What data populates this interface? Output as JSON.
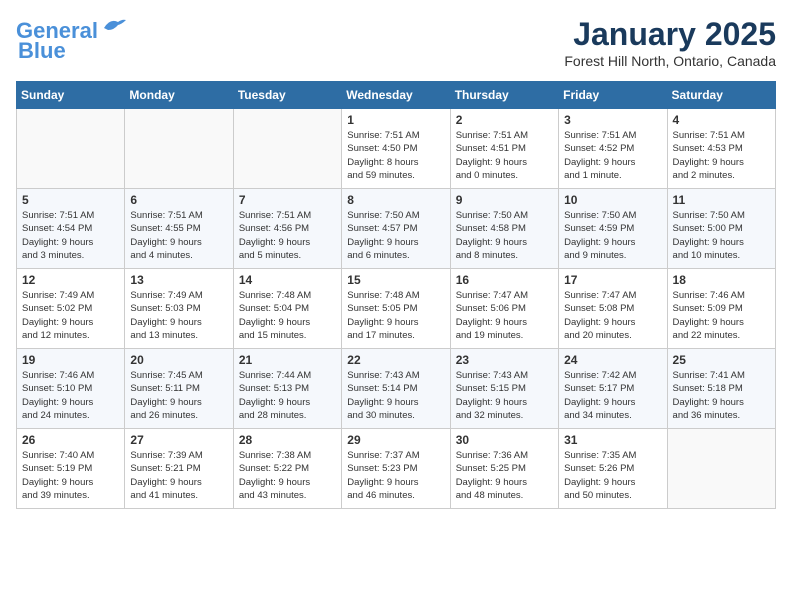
{
  "header": {
    "logo_general": "General",
    "logo_blue": "Blue",
    "month": "January 2025",
    "location": "Forest Hill North, Ontario, Canada"
  },
  "days_of_week": [
    "Sunday",
    "Monday",
    "Tuesday",
    "Wednesday",
    "Thursday",
    "Friday",
    "Saturday"
  ],
  "weeks": [
    [
      {
        "day": "",
        "info": ""
      },
      {
        "day": "",
        "info": ""
      },
      {
        "day": "",
        "info": ""
      },
      {
        "day": "1",
        "info": "Sunrise: 7:51 AM\nSunset: 4:50 PM\nDaylight: 8 hours\nand 59 minutes."
      },
      {
        "day": "2",
        "info": "Sunrise: 7:51 AM\nSunset: 4:51 PM\nDaylight: 9 hours\nand 0 minutes."
      },
      {
        "day": "3",
        "info": "Sunrise: 7:51 AM\nSunset: 4:52 PM\nDaylight: 9 hours\nand 1 minute."
      },
      {
        "day": "4",
        "info": "Sunrise: 7:51 AM\nSunset: 4:53 PM\nDaylight: 9 hours\nand 2 minutes."
      }
    ],
    [
      {
        "day": "5",
        "info": "Sunrise: 7:51 AM\nSunset: 4:54 PM\nDaylight: 9 hours\nand 3 minutes."
      },
      {
        "day": "6",
        "info": "Sunrise: 7:51 AM\nSunset: 4:55 PM\nDaylight: 9 hours\nand 4 minutes."
      },
      {
        "day": "7",
        "info": "Sunrise: 7:51 AM\nSunset: 4:56 PM\nDaylight: 9 hours\nand 5 minutes."
      },
      {
        "day": "8",
        "info": "Sunrise: 7:50 AM\nSunset: 4:57 PM\nDaylight: 9 hours\nand 6 minutes."
      },
      {
        "day": "9",
        "info": "Sunrise: 7:50 AM\nSunset: 4:58 PM\nDaylight: 9 hours\nand 8 minutes."
      },
      {
        "day": "10",
        "info": "Sunrise: 7:50 AM\nSunset: 4:59 PM\nDaylight: 9 hours\nand 9 minutes."
      },
      {
        "day": "11",
        "info": "Sunrise: 7:50 AM\nSunset: 5:00 PM\nDaylight: 9 hours\nand 10 minutes."
      }
    ],
    [
      {
        "day": "12",
        "info": "Sunrise: 7:49 AM\nSunset: 5:02 PM\nDaylight: 9 hours\nand 12 minutes."
      },
      {
        "day": "13",
        "info": "Sunrise: 7:49 AM\nSunset: 5:03 PM\nDaylight: 9 hours\nand 13 minutes."
      },
      {
        "day": "14",
        "info": "Sunrise: 7:48 AM\nSunset: 5:04 PM\nDaylight: 9 hours\nand 15 minutes."
      },
      {
        "day": "15",
        "info": "Sunrise: 7:48 AM\nSunset: 5:05 PM\nDaylight: 9 hours\nand 17 minutes."
      },
      {
        "day": "16",
        "info": "Sunrise: 7:47 AM\nSunset: 5:06 PM\nDaylight: 9 hours\nand 19 minutes."
      },
      {
        "day": "17",
        "info": "Sunrise: 7:47 AM\nSunset: 5:08 PM\nDaylight: 9 hours\nand 20 minutes."
      },
      {
        "day": "18",
        "info": "Sunrise: 7:46 AM\nSunset: 5:09 PM\nDaylight: 9 hours\nand 22 minutes."
      }
    ],
    [
      {
        "day": "19",
        "info": "Sunrise: 7:46 AM\nSunset: 5:10 PM\nDaylight: 9 hours\nand 24 minutes."
      },
      {
        "day": "20",
        "info": "Sunrise: 7:45 AM\nSunset: 5:11 PM\nDaylight: 9 hours\nand 26 minutes."
      },
      {
        "day": "21",
        "info": "Sunrise: 7:44 AM\nSunset: 5:13 PM\nDaylight: 9 hours\nand 28 minutes."
      },
      {
        "day": "22",
        "info": "Sunrise: 7:43 AM\nSunset: 5:14 PM\nDaylight: 9 hours\nand 30 minutes."
      },
      {
        "day": "23",
        "info": "Sunrise: 7:43 AM\nSunset: 5:15 PM\nDaylight: 9 hours\nand 32 minutes."
      },
      {
        "day": "24",
        "info": "Sunrise: 7:42 AM\nSunset: 5:17 PM\nDaylight: 9 hours\nand 34 minutes."
      },
      {
        "day": "25",
        "info": "Sunrise: 7:41 AM\nSunset: 5:18 PM\nDaylight: 9 hours\nand 36 minutes."
      }
    ],
    [
      {
        "day": "26",
        "info": "Sunrise: 7:40 AM\nSunset: 5:19 PM\nDaylight: 9 hours\nand 39 minutes."
      },
      {
        "day": "27",
        "info": "Sunrise: 7:39 AM\nSunset: 5:21 PM\nDaylight: 9 hours\nand 41 minutes."
      },
      {
        "day": "28",
        "info": "Sunrise: 7:38 AM\nSunset: 5:22 PM\nDaylight: 9 hours\nand 43 minutes."
      },
      {
        "day": "29",
        "info": "Sunrise: 7:37 AM\nSunset: 5:23 PM\nDaylight: 9 hours\nand 46 minutes."
      },
      {
        "day": "30",
        "info": "Sunrise: 7:36 AM\nSunset: 5:25 PM\nDaylight: 9 hours\nand 48 minutes."
      },
      {
        "day": "31",
        "info": "Sunrise: 7:35 AM\nSunset: 5:26 PM\nDaylight: 9 hours\nand 50 minutes."
      },
      {
        "day": "",
        "info": ""
      }
    ]
  ]
}
